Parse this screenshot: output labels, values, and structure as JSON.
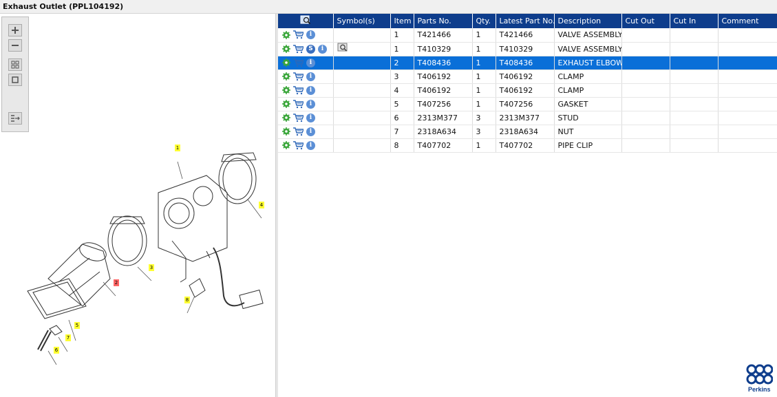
{
  "window": {
    "title": "Exhaust Outlet (PPL104192)"
  },
  "toolbar": {
    "buttons": [
      {
        "name": "zoom-in",
        "icon": "plus-icon"
      },
      {
        "name": "zoom-out",
        "icon": "minus-icon"
      },
      {
        "name": "fit-view",
        "icon": "grid-icon"
      },
      {
        "name": "actual-size",
        "icon": "square-icon"
      },
      {
        "name": "export",
        "icon": "list-arrow-icon"
      }
    ]
  },
  "callouts": [
    "1",
    "2",
    "3",
    "4",
    "5",
    "6",
    "7",
    "8"
  ],
  "table": {
    "columns": [
      "",
      "Symbol(s)",
      "Item",
      "Parts No.",
      "Qty.",
      "Latest Part No.",
      "Description",
      "Cut Out",
      "Cut In",
      "Comment"
    ],
    "rows": [
      {
        "item": "1",
        "part_no": "T421466",
        "qty": "1",
        "latest": "T421466",
        "description": "VALVE ASSEMBLY",
        "cut_out": "",
        "cut_in": "",
        "comment": "",
        "has_s": false,
        "has_symbol": false,
        "selected": false
      },
      {
        "item": "1",
        "part_no": "T410329",
        "qty": "1",
        "latest": "T410329",
        "description": "VALVE ASSEMBLY",
        "cut_out": "",
        "cut_in": "",
        "comment": "",
        "has_s": true,
        "has_symbol": true,
        "selected": false
      },
      {
        "item": "2",
        "part_no": "T408436",
        "qty": "1",
        "latest": "T408436",
        "description": "EXHAUST ELBOW",
        "cut_out": "",
        "cut_in": "",
        "comment": "",
        "has_s": false,
        "has_symbol": false,
        "selected": true
      },
      {
        "item": "3",
        "part_no": "T406192",
        "qty": "1",
        "latest": "T406192",
        "description": "CLAMP",
        "cut_out": "",
        "cut_in": "",
        "comment": "",
        "has_s": false,
        "has_symbol": false,
        "selected": false
      },
      {
        "item": "4",
        "part_no": "T406192",
        "qty": "1",
        "latest": "T406192",
        "description": "CLAMP",
        "cut_out": "",
        "cut_in": "",
        "comment": "",
        "has_s": false,
        "has_symbol": false,
        "selected": false
      },
      {
        "item": "5",
        "part_no": "T407256",
        "qty": "1",
        "latest": "T407256",
        "description": "GASKET",
        "cut_out": "",
        "cut_in": "",
        "comment": "",
        "has_s": false,
        "has_symbol": false,
        "selected": false
      },
      {
        "item": "6",
        "part_no": "2313M377",
        "qty": "3",
        "latest": "2313M377",
        "description": "STUD",
        "cut_out": "",
        "cut_in": "",
        "comment": "",
        "has_s": false,
        "has_symbol": false,
        "selected": false
      },
      {
        "item": "7",
        "part_no": "2318A634",
        "qty": "3",
        "latest": "2318A634",
        "description": "NUT",
        "cut_out": "",
        "cut_in": "",
        "comment": "",
        "has_s": false,
        "has_symbol": false,
        "selected": false
      },
      {
        "item": "8",
        "part_no": "T407702",
        "qty": "1",
        "latest": "T407702",
        "description": "PIPE CLIP",
        "cut_out": "",
        "cut_in": "",
        "comment": "",
        "has_s": false,
        "has_symbol": false,
        "selected": false
      }
    ]
  },
  "logo": {
    "text": "Perkins"
  },
  "colors": {
    "header": "#0e3d8c",
    "selected_row": "#0a6fd8",
    "callout": "#ffff33",
    "callout_selected": "#ff6666",
    "gear": "#3aa63a",
    "cart": "#2f68b8"
  }
}
